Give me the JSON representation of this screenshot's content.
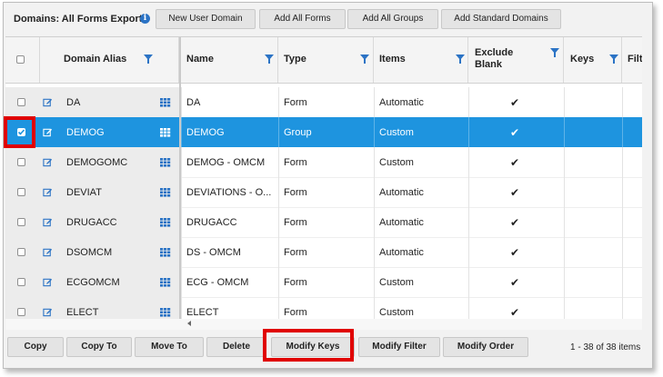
{
  "title": "Domains: All Forms Export",
  "toolbar": {
    "new_user_domain": "New User Domain",
    "add_all_forms": "Add All Forms",
    "add_all_groups": "Add All Groups",
    "add_standard_domains": "Add Standard Domains"
  },
  "columns": {
    "domain_alias": "Domain Alias",
    "name": "Name",
    "type": "Type",
    "items": "Items",
    "exclude_blank_1": "Exclude",
    "exclude_blank_2": "Blank",
    "keys": "Keys",
    "filter": "Filte"
  },
  "rows": [
    {
      "alias": "DA",
      "name": "DA",
      "type": "Form",
      "items": "Automatic",
      "exclude_blank": true,
      "selected": false
    },
    {
      "alias": "DEMOG",
      "name": "DEMOG",
      "type": "Group",
      "items": "Custom",
      "exclude_blank": true,
      "selected": true
    },
    {
      "alias": "DEMOGOMC",
      "name": "DEMOG - OMCM",
      "type": "Form",
      "items": "Custom",
      "exclude_blank": true,
      "selected": false
    },
    {
      "alias": "DEVIAT",
      "name": "DEVIATIONS - O...",
      "type": "Form",
      "items": "Automatic",
      "exclude_blank": true,
      "selected": false
    },
    {
      "alias": "DRUGACC",
      "name": "DRUGACC",
      "type": "Form",
      "items": "Automatic",
      "exclude_blank": true,
      "selected": false
    },
    {
      "alias": "DSOMCM",
      "name": "DS - OMCM",
      "type": "Form",
      "items": "Automatic",
      "exclude_blank": true,
      "selected": false
    },
    {
      "alias": "ECGOMCM",
      "name": "ECG - OMCM",
      "type": "Form",
      "items": "Custom",
      "exclude_blank": true,
      "selected": false
    },
    {
      "alias": "ELECT",
      "name": "ELECT",
      "type": "Form",
      "items": "Custom",
      "exclude_blank": true,
      "selected": false
    }
  ],
  "bottom": {
    "copy": "Copy",
    "copy_to": "Copy To",
    "move_to": "Move To",
    "delete": "Delete",
    "modify_keys": "Modify Keys",
    "modify_filter": "Modify Filter",
    "modify_order": "Modify Order",
    "count": "1 - 38 of 38 items"
  },
  "colors": {
    "selected_row": "#1e94df",
    "highlight": "#e00000",
    "filter_icon": "#2b73c5"
  },
  "icons": [
    "info-icon",
    "filter-icon",
    "edit-icon",
    "grid-icon",
    "checkmark-icon"
  ]
}
